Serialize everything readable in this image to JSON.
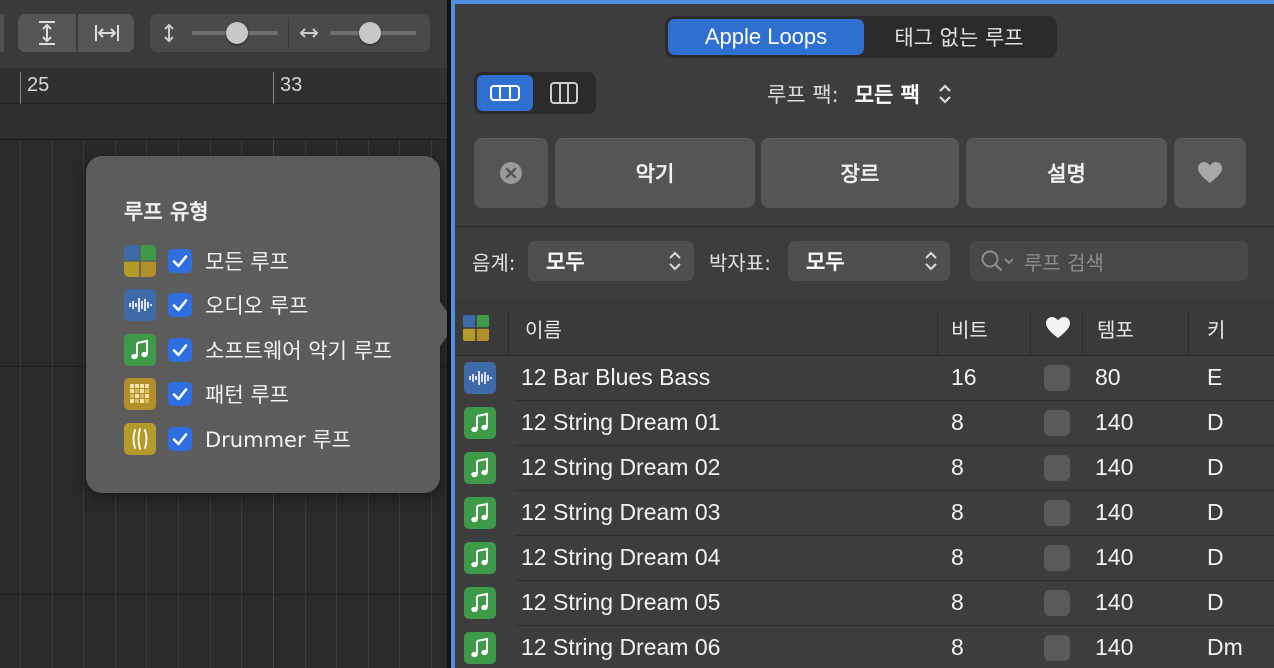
{
  "ruler": {
    "bar1": "25",
    "bar2": "33"
  },
  "loop_types_popover": {
    "title": "루프 유형",
    "items": [
      {
        "label": "모든 루프",
        "icon": "all-loops-icon",
        "checked": true
      },
      {
        "label": "오디오 루프",
        "icon": "audio-waveform-icon",
        "checked": true
      },
      {
        "label": "소프트웨어 악기 루프",
        "icon": "music-note-icon",
        "checked": true
      },
      {
        "label": "패턴 루프",
        "icon": "pattern-grid-icon",
        "checked": true
      },
      {
        "label": "Drummer 루프",
        "icon": "drummer-icon",
        "checked": true
      }
    ]
  },
  "browser": {
    "tabs": {
      "active": "Apple Loops",
      "inactive": "태그 없는 루프"
    },
    "loop_pack": {
      "label": "루프 팩:",
      "value": "모든 팩"
    },
    "filter_buttons": {
      "instrument": "악기",
      "genre": "장르",
      "descriptor": "설명"
    },
    "scale": {
      "label": "음계:",
      "value": "모두"
    },
    "signature": {
      "label": "박자표:",
      "value": "모두"
    },
    "search": {
      "placeholder": "루프 검색"
    },
    "columns": {
      "name": "이름",
      "beats": "비트",
      "tempo": "템포",
      "key": "키"
    },
    "rows": [
      {
        "type": "audio",
        "name": "12 Bar Blues Bass",
        "beats": "16",
        "tempo": "80",
        "key": "E"
      },
      {
        "type": "software",
        "name": "12 String Dream 01",
        "beats": "8",
        "tempo": "140",
        "key": "D"
      },
      {
        "type": "software",
        "name": "12 String Dream 02",
        "beats": "8",
        "tempo": "140",
        "key": "D"
      },
      {
        "type": "software",
        "name": "12 String Dream 03",
        "beats": "8",
        "tempo": "140",
        "key": "D"
      },
      {
        "type": "software",
        "name": "12 String Dream 04",
        "beats": "8",
        "tempo": "140",
        "key": "D"
      },
      {
        "type": "software",
        "name": "12 String Dream 05",
        "beats": "8",
        "tempo": "140",
        "key": "D"
      },
      {
        "type": "software",
        "name": "12 String Dream 06",
        "beats": "8",
        "tempo": "140",
        "key": "Dm"
      }
    ]
  },
  "colors": {
    "accent": "#2f6fd0",
    "audio": "#3f6aa8",
    "software": "#3e9a48",
    "pattern": "#b38f2a",
    "drummer": "#b39a2a"
  }
}
